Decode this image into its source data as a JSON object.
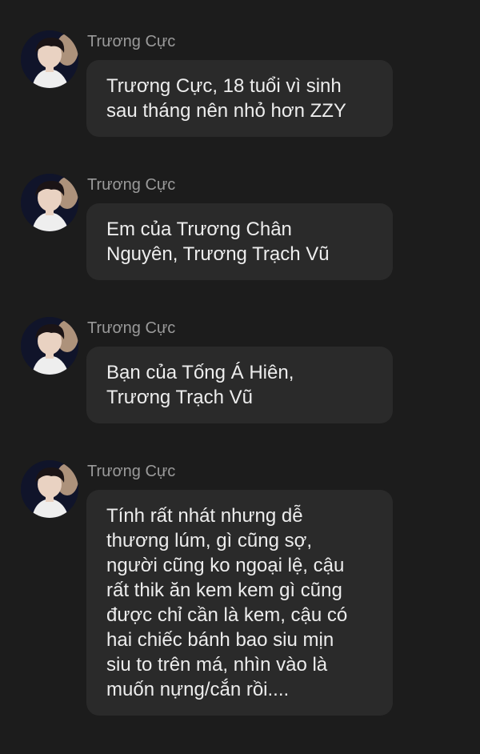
{
  "colors": {
    "background": "#1c1c1c",
    "bubble": "#2a2a2a",
    "sender_text": "#9a9a9a",
    "message_text": "#ededed"
  },
  "messages": [
    {
      "sender": "Trương Cực",
      "avatar_icon": "profile-photo",
      "lines": [
        "Trương Cực, 18 tuổi vì sinh",
        "sau tháng nên nhỏ hơn ZZY"
      ]
    },
    {
      "sender": "Trương Cực",
      "avatar_icon": "profile-photo",
      "lines": [
        "Em của Trương Chân",
        "Nguyên, Trương Trạch Vũ"
      ]
    },
    {
      "sender": "Trương Cực",
      "avatar_icon": "profile-photo",
      "lines": [
        "Bạn của Tống Á Hiên,",
        "Trương Trạch Vũ"
      ]
    },
    {
      "sender": "Trương Cực",
      "avatar_icon": "profile-photo",
      "lines": [
        "Tính rất nhát nhưng dễ",
        "thương lúm, gì cũng sợ,",
        "người cũng ko ngoại lệ, cậu",
        "rất thik ăn kem kem gì cũng",
        "được chỉ cần là kem, cậu có",
        "hai chiếc bánh bao siu mịn",
        "siu to trên má, nhìn vào là",
        "muốn nựng/cắn rồi...."
      ]
    }
  ]
}
